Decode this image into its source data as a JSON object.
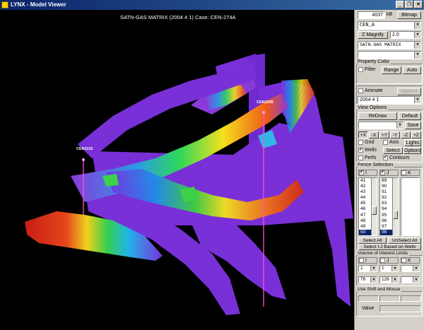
{
  "window": {
    "title": "LYNX - Model Viewer",
    "min": "_",
    "restore": "❐",
    "close": "✕"
  },
  "viewport": {
    "header": "SATN-GAS MATRIX (2004  4  1) Case: CEN-274A",
    "well_labels": [
      "CEN1006",
      "CEN1132"
    ]
  },
  "panel": {
    "mem_value": "4037",
    "mem_unit": "kB",
    "bitmap": "Bitmap",
    "case_select": "CEN_A",
    "zmag_label": "Z Magnify",
    "zmag_value": "2.0",
    "property_select": "SATN-GAS MATRIX",
    "blank_select": "",
    "property_color": {
      "title": "Property Color",
      "filter": "Filter",
      "range": "Range",
      "auto": "Auto"
    },
    "animate": {
      "label": "Animate",
      "options": "Options",
      "date": "2004   4   1"
    },
    "view_options": {
      "title": "View Options",
      "redraw": "ReDraw",
      "default": "Default",
      "save": "Save",
      "axis_buttons": [
        "+X",
        "-X",
        "+Y",
        "-Y",
        "-Z",
        "+Z"
      ],
      "grid": "Grid",
      "axis": "Axis",
      "lights": "Lights",
      "wells": "Wells",
      "select": "Select",
      "options": "Options",
      "perfs": "Perfs",
      "contours": "Contours"
    },
    "fence": {
      "title": "Fence Selection",
      "i_label": "I",
      "j_label": "J",
      "k_label": "K",
      "i_list": [
        "41",
        "42",
        "43",
        "44",
        "45",
        "46",
        "47",
        "48",
        "49",
        "50"
      ],
      "j_list": [
        "89",
        "90",
        "91",
        "92",
        "93",
        "94",
        "95",
        "96",
        "97",
        "98"
      ],
      "select_all": "Select All",
      "unselect_all": "UnSelect All",
      "select_ij": "Select I-J Based on Wells"
    },
    "voi": {
      "title": "Volume of Interest Limits",
      "i": "I",
      "j": "J",
      "k": "K",
      "i_min": "1",
      "j_min": "1",
      "k_min": "",
      "i_max": "76",
      "j_max": "126",
      "k_max": ""
    },
    "mouse": {
      "title": "Use Shift and Mouse",
      "value_label": "Value"
    }
  }
}
